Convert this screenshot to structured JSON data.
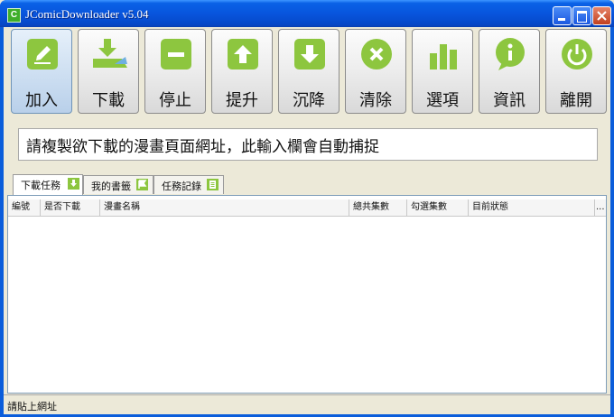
{
  "window": {
    "title": "JComicDownloader  v5.04",
    "app_icon_letter": "C"
  },
  "toolbar": {
    "buttons": [
      {
        "label": "加入",
        "icon": "pencil-icon",
        "name": "add-button"
      },
      {
        "label": "下載",
        "icon": "download-tray-icon",
        "name": "download-button"
      },
      {
        "label": "停止",
        "icon": "minus-icon",
        "name": "stop-button"
      },
      {
        "label": "提升",
        "icon": "arrow-up-icon",
        "name": "move-up-button"
      },
      {
        "label": "沉降",
        "icon": "arrow-down-icon",
        "name": "move-down-button"
      },
      {
        "label": "清除",
        "icon": "x-circle-icon",
        "name": "clear-button"
      },
      {
        "label": "選項",
        "icon": "bar-chart-icon",
        "name": "options-button"
      },
      {
        "label": "資訊",
        "icon": "info-bubble-icon",
        "name": "info-button"
      },
      {
        "label": "離開",
        "icon": "power-icon",
        "name": "exit-button"
      }
    ]
  },
  "url_field": {
    "value": "請複製欲下載的漫畫頁面網址，此輸入欄會自動捕捉"
  },
  "tabs": [
    {
      "label": "下載任務",
      "icon": "download-arrow-icon",
      "active": true
    },
    {
      "label": "我的書籤",
      "icon": "flag-icon",
      "active": false
    },
    {
      "label": "任務記錄",
      "icon": "document-icon",
      "active": false
    }
  ],
  "table": {
    "columns": [
      "編號",
      "是否下載",
      "漫畫名稱",
      "總共集數",
      "勾選集數",
      "目前狀態",
      "..."
    ],
    "rows": []
  },
  "status_bar": {
    "text": "請貼上網址"
  },
  "colors": {
    "icon_green": "#8dc63f",
    "titlebar_blue": "#0855dd"
  }
}
